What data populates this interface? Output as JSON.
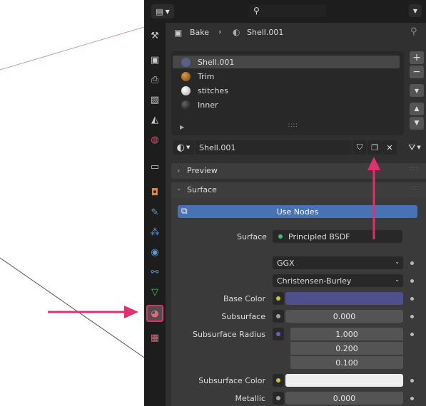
{
  "breadcrumb": {
    "object": "Bake",
    "material": "Shell.001"
  },
  "material_slots": [
    {
      "name": "Shell.001",
      "ball": "#5a5f8a",
      "selected": true
    },
    {
      "name": "Trim",
      "ball": "#a9701f",
      "selected": false
    },
    {
      "name": "stitches",
      "ball": "#d8d8d8",
      "selected": false
    },
    {
      "name": "Inner",
      "ball": "#2a2a2a",
      "selected": false
    }
  ],
  "slot_controls": {
    "add": "+",
    "remove": "−"
  },
  "datablock": {
    "name": "Shell.001"
  },
  "panels": {
    "preview": "Preview",
    "surface": "Surface"
  },
  "use_nodes_label": "Use Nodes",
  "surface": {
    "label": "Surface",
    "shader": "Principled BSDF",
    "distribution": "GGX",
    "subsurface_method": "Christensen-Burley"
  },
  "props": {
    "base_color": {
      "label": "Base Color",
      "color": "#4f4f8c"
    },
    "subsurface": {
      "label": "Subsurface",
      "value": "0.000"
    },
    "subsurface_radius": {
      "label": "Subsurface Radius",
      "values": [
        "1.000",
        "0.200",
        "0.100"
      ]
    },
    "subsurface_color": {
      "label": "Subsurface Color",
      "color": "#eeeeee"
    },
    "metallic": {
      "label": "Metallic",
      "value": "0.000"
    }
  },
  "colors": {
    "accent": "#4772b3",
    "annotation": "#e0316f",
    "active_tab": "#4e4e4e"
  }
}
